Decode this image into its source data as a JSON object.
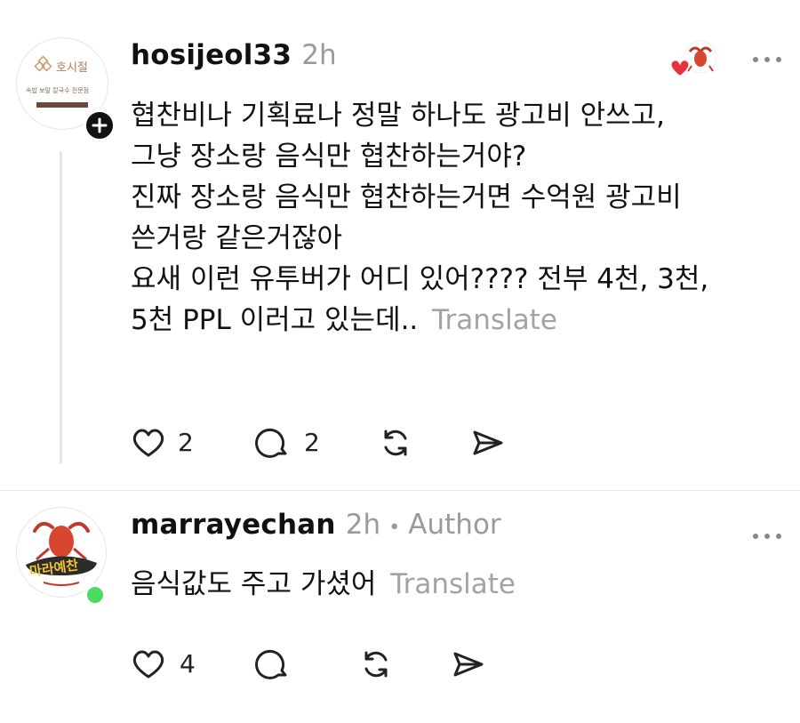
{
  "post": {
    "username": "hosijeol33",
    "time": "2h",
    "avatar_brand": "호시절",
    "avatar_sub": "속밥 보말 칼국수 전문점",
    "lines": [
      "협찬비나 기획료나 정말 하나도 광고비 안쓰고,",
      "그냥 장소랑 음식만 협찬하는거야?",
      "진짜 장소랑 음식만 협찬하는거면 수억원 광고비",
      "쓴거랑 같은거잖아",
      "요새 이런 유투버가 어디 있어???? 전부 4천, 3천,",
      "5천 PPL 이러고 있는데.."
    ],
    "translate": "Translate",
    "like_count": "2",
    "reply_count": "2"
  },
  "reply": {
    "username": "marrayechan",
    "time": "2h",
    "separator": "•",
    "author_badge": "Author",
    "avatar_brand": "마라예찬",
    "text": "음식값도 주고 가셨어",
    "translate": "Translate",
    "like_count": "4"
  },
  "icons": {
    "more": "more-dots-icon",
    "heart": "heart-icon",
    "comment": "comment-icon",
    "repost": "repost-icon",
    "share": "share-icon",
    "follow": "plus-icon",
    "liked_by_author": "heart-icon",
    "online": "online-dot-icon"
  },
  "colors": {
    "liked_heart": "#e8323c",
    "online_green": "#4cd964",
    "meta_gray": "#9a9a9a"
  }
}
